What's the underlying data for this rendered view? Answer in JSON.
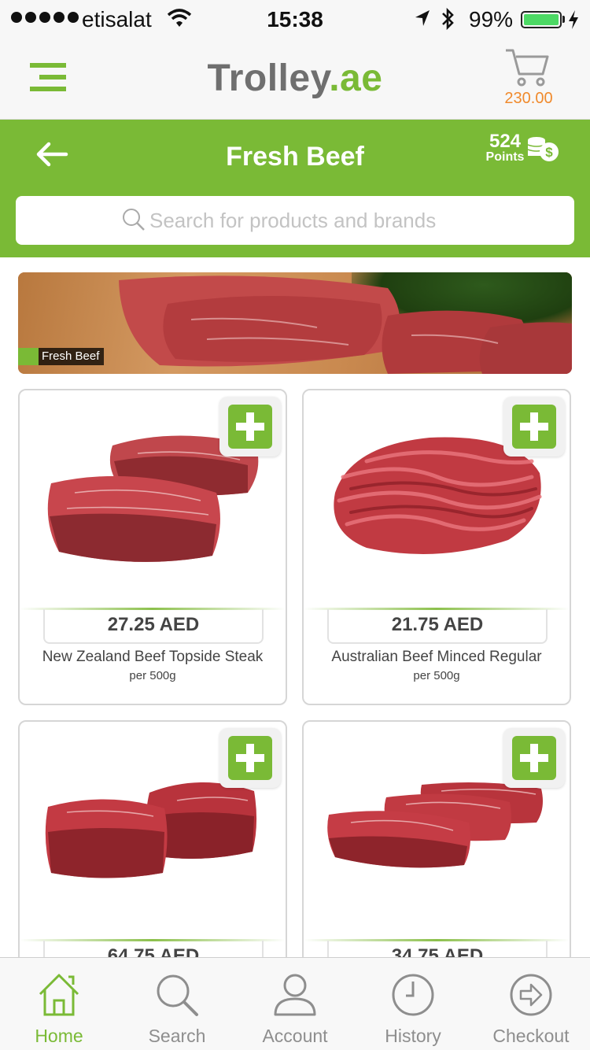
{
  "status_bar": {
    "carrier": "etisalat",
    "time": "15:38",
    "battery": "99%"
  },
  "header": {
    "logo_main": "Trolley",
    "logo_tld": ".ae",
    "cart_total": "230.00"
  },
  "category_bar": {
    "title": "Fresh Beef",
    "points_value": "524",
    "points_label": "Points"
  },
  "search": {
    "placeholder": "Search for products and brands"
  },
  "banner": {
    "label": "Fresh Beef"
  },
  "products": [
    {
      "price": "27.25 AED",
      "name": "New Zealand Beef Topside Steak",
      "unit": "per 500g",
      "image": "steak-slices"
    },
    {
      "price": "21.75 AED",
      "name": "Australian Beef Minced Regular",
      "unit": "per 500g",
      "image": "minced-beef"
    },
    {
      "price": "64.75 AED",
      "name": "",
      "unit": "",
      "image": "tenderloin-medallions"
    },
    {
      "price": "34.75 AED",
      "name": "",
      "unit": "",
      "image": "striploin-steaks"
    }
  ],
  "tabs": [
    {
      "label": "Home",
      "icon": "home-icon",
      "active": true
    },
    {
      "label": "Search",
      "icon": "search-icon",
      "active": false
    },
    {
      "label": "Account",
      "icon": "account-icon",
      "active": false
    },
    {
      "label": "History",
      "icon": "history-icon",
      "active": false
    },
    {
      "label": "Checkout",
      "icon": "checkout-icon",
      "active": false
    }
  ],
  "colors": {
    "brand_green": "#7aba36",
    "cart_orange": "#f08a2c",
    "logo_gray": "#6f6f6f"
  }
}
